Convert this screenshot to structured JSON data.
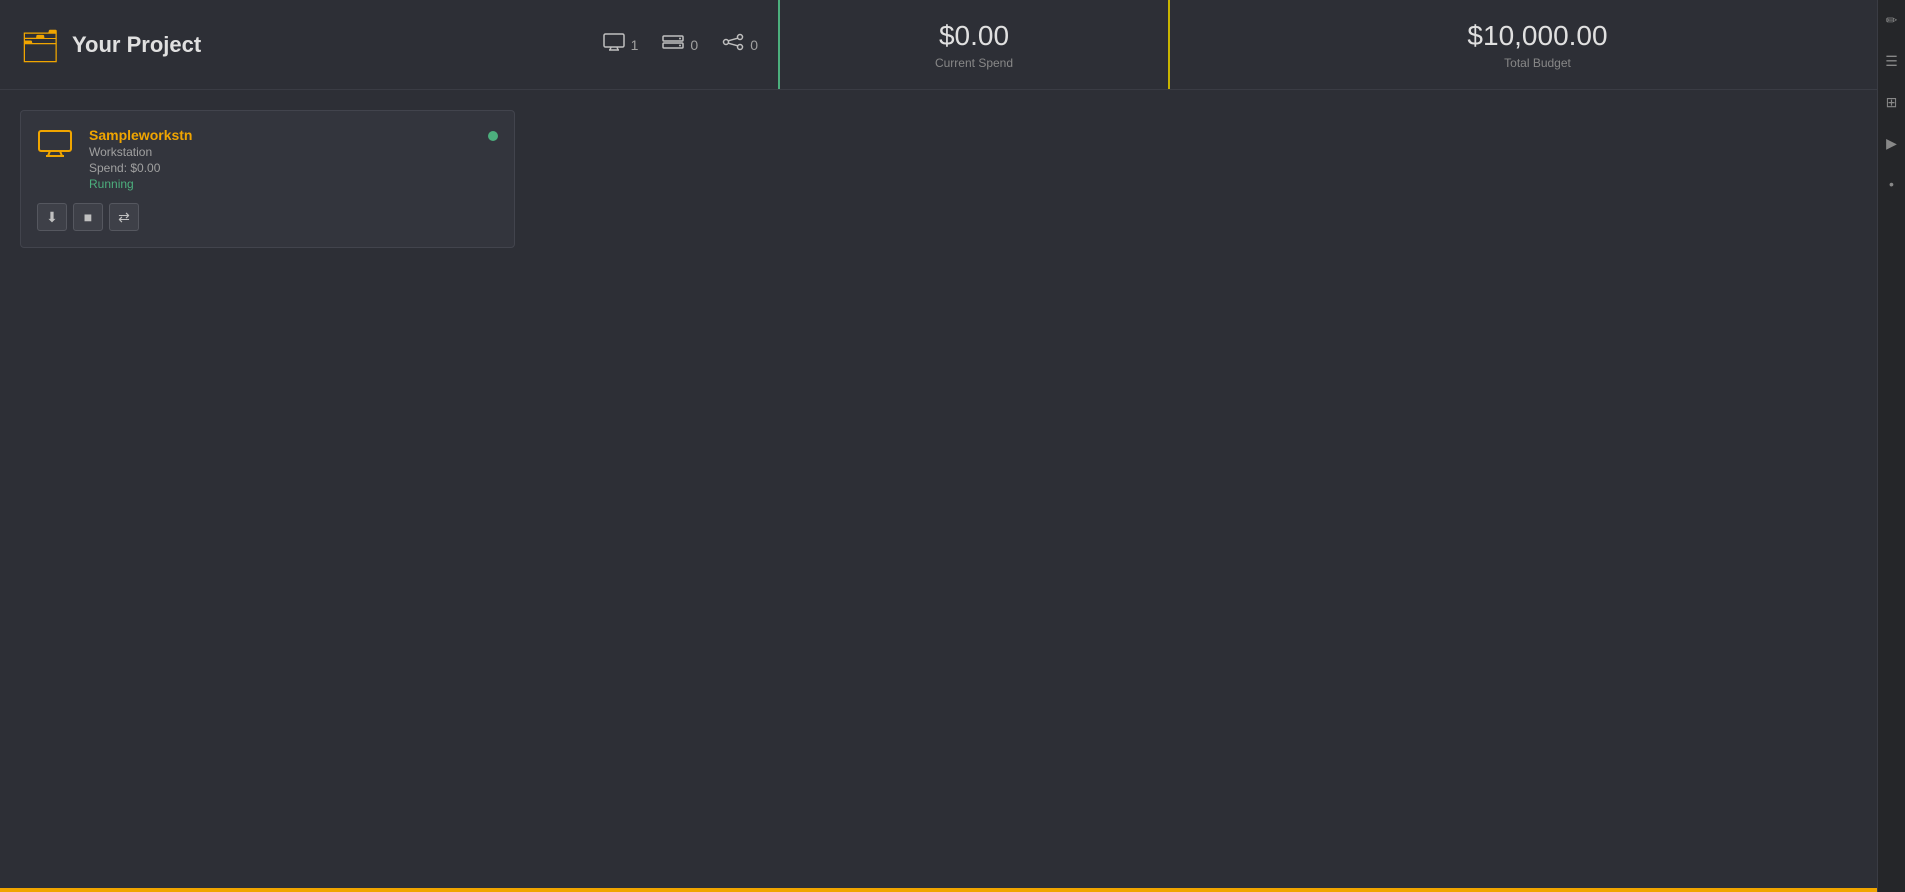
{
  "project": {
    "title": "Your Project",
    "folder_icon": "📁"
  },
  "resources": {
    "workstations": {
      "count": "1",
      "icon": "monitor"
    },
    "storage": {
      "count": "0",
      "icon": "storage"
    },
    "shares": {
      "count": "0",
      "icon": "share"
    }
  },
  "finances": {
    "current_spend": "$0.00",
    "current_spend_label": "Current Spend",
    "total_budget": "$10,000.00",
    "total_budget_label": "Total Budget"
  },
  "workstation_card": {
    "name": "Sampleworkstn",
    "type": "Workstation",
    "spend": "Spend: $0.00",
    "status": "Running",
    "status_color": "#4caf7d",
    "icon_color": "#f0a500"
  },
  "card_actions": {
    "download": "⬇",
    "stop": "■",
    "reconnect": "⇄"
  },
  "sidebar_icons": {
    "edit": "✏",
    "settings1": "☰",
    "settings2": "⊞",
    "map": "▶",
    "dot": "•"
  }
}
